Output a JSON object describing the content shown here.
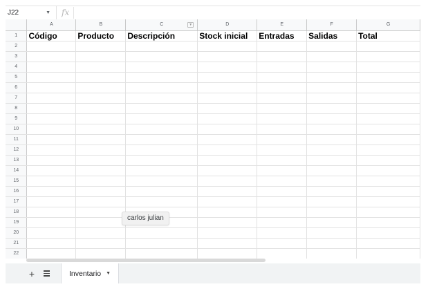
{
  "formula_bar": {
    "cell_ref": "J22",
    "fx_symbol": "fx",
    "formula": ""
  },
  "columns": [
    "A",
    "B",
    "C",
    "D",
    "E",
    "F",
    "G"
  ],
  "row_numbers": [
    "1",
    "2",
    "3",
    "4",
    "5",
    "6",
    "7",
    "8",
    "9",
    "10",
    "11",
    "12",
    "13",
    "14",
    "15",
    "16",
    "17",
    "18",
    "19",
    "20",
    "21",
    "22"
  ],
  "headers": [
    "Código",
    "Producto",
    "Descripción",
    "Stock inicial",
    "Entradas",
    "Salidas",
    "Total"
  ],
  "tooltip": {
    "text": "carlos julian"
  },
  "sheets": {
    "add_icon": "+",
    "active_tab": "Inventario"
  },
  "colors": {
    "header_bg": "#f8f9fa",
    "gridline": "#e2e2e2",
    "tab_bg": "#f1f3f4"
  },
  "icons": [
    "chevron-down-icon",
    "fx-icon",
    "filter-icon",
    "plus-icon",
    "sheets-list-icon"
  ]
}
